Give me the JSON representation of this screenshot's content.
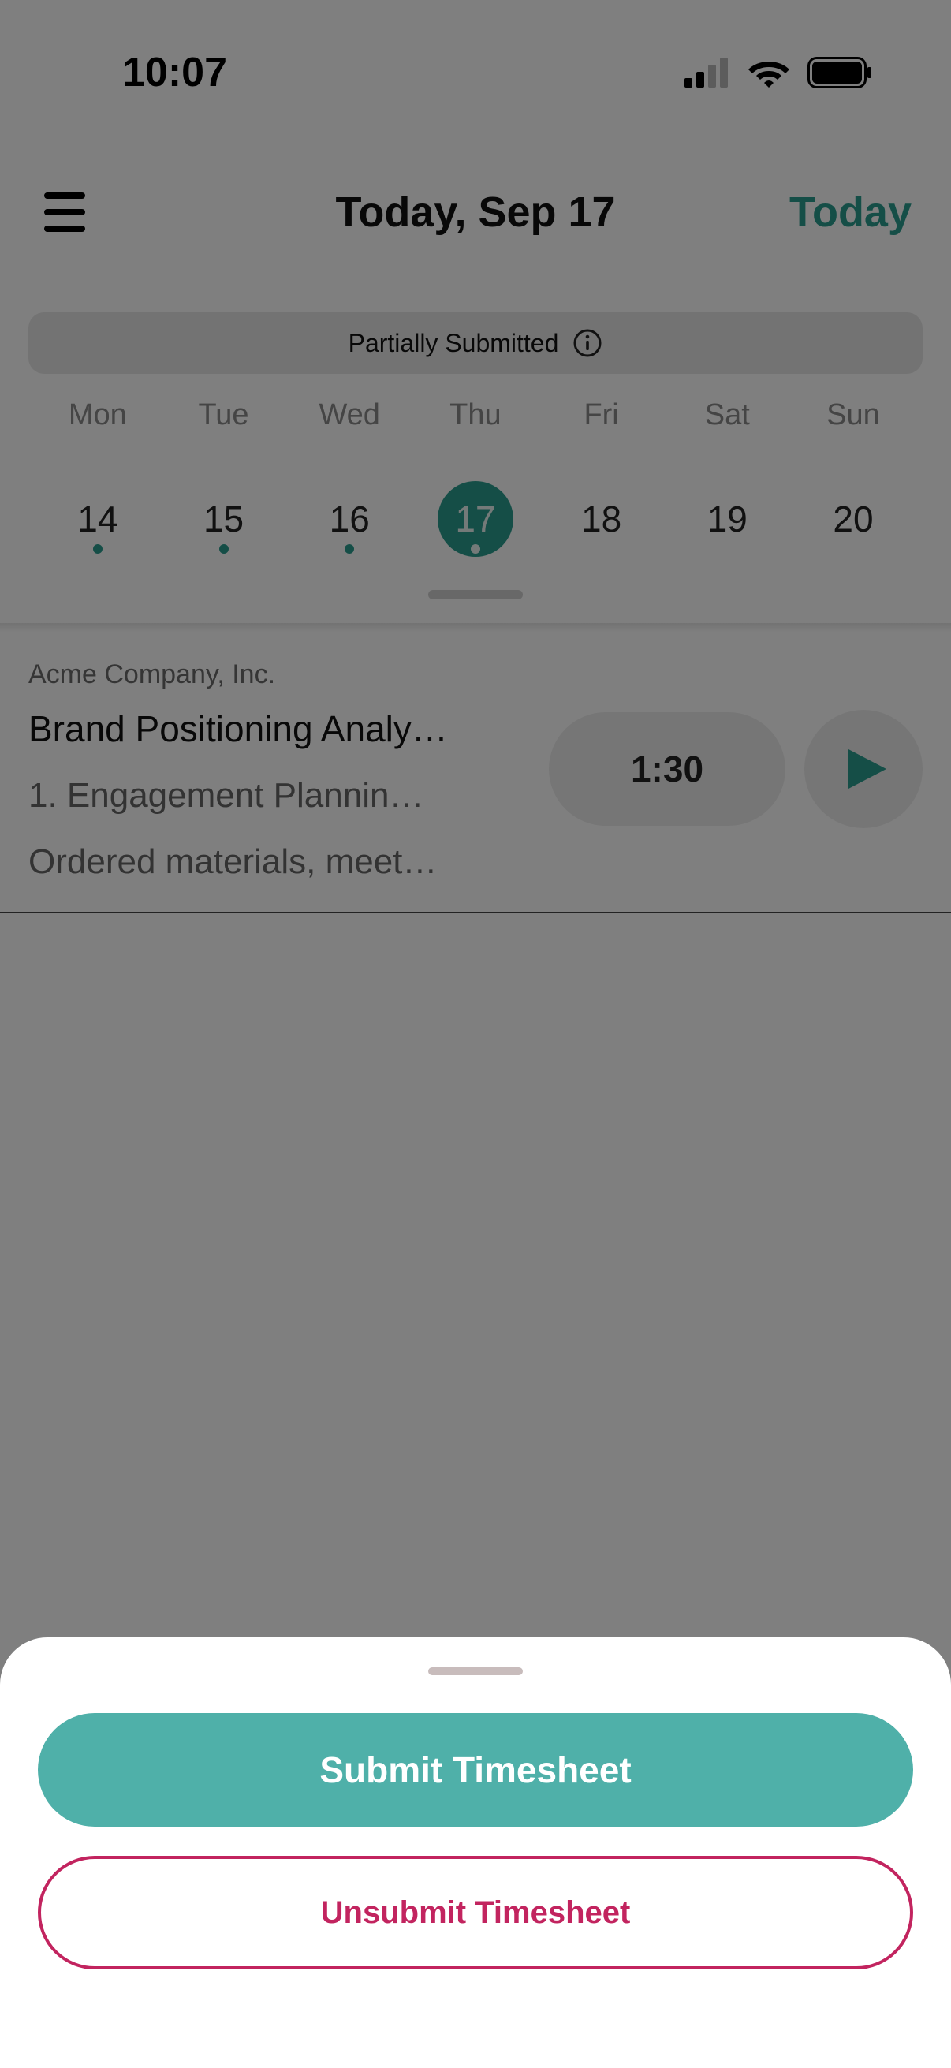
{
  "status_bar": {
    "time": "10:07"
  },
  "header": {
    "title": "Today, Sep 17",
    "today_label": "Today"
  },
  "timesheet_status": {
    "label": "Partially Submitted"
  },
  "week": {
    "days": [
      {
        "label": "Mon",
        "date": "14",
        "has_entries": true,
        "selected": false
      },
      {
        "label": "Tue",
        "date": "15",
        "has_entries": true,
        "selected": false
      },
      {
        "label": "Wed",
        "date": "16",
        "has_entries": true,
        "selected": false
      },
      {
        "label": "Thu",
        "date": "17",
        "has_entries": true,
        "selected": true
      },
      {
        "label": "Fri",
        "date": "18",
        "has_entries": false,
        "selected": false
      },
      {
        "label": "Sat",
        "date": "19",
        "has_entries": false,
        "selected": false
      },
      {
        "label": "Sun",
        "date": "20",
        "has_entries": false,
        "selected": false
      }
    ]
  },
  "entries": [
    {
      "company": "Acme Company, Inc.",
      "project": "Brand Positioning Analy…",
      "task": "1. Engagement Plannin…",
      "notes": "Ordered materials, meet…",
      "duration": "1:30"
    }
  ],
  "sheet": {
    "submit_label": "Submit Timesheet",
    "unsubmit_label": "Unsubmit Timesheet"
  },
  "colors": {
    "accent": "#2a9d8f",
    "submit_bg": "#4fb0a9",
    "unsubmit": "#c2245f"
  },
  "icons": {
    "menu": "hamburger-menu-icon",
    "info": "info-icon",
    "play": "play-icon",
    "signal": "cellular-signal-icon",
    "wifi": "wifi-icon",
    "battery": "battery-icon"
  }
}
